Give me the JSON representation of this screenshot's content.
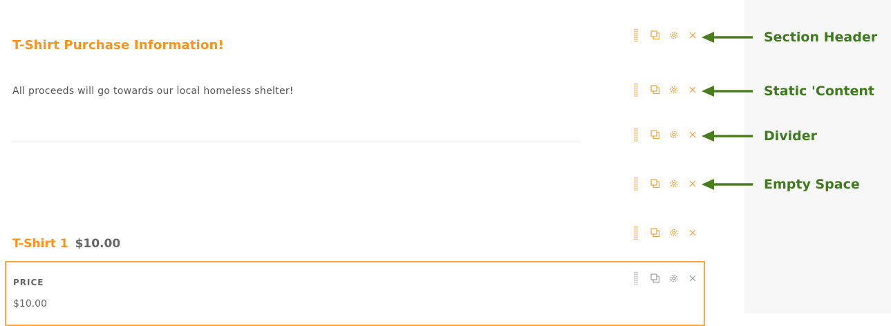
{
  "form": {
    "section_header": "T-Shirt Purchase Information!",
    "static_content": "All proceeds will go towards our local homeless shelter!",
    "product": {
      "name": "T-Shirt 1",
      "price": "$10.00"
    },
    "price_field": {
      "label": "PRICE",
      "value": "$10.00"
    }
  },
  "annotations": [
    {
      "label": "Section Header"
    },
    {
      "label": "Static 'Content"
    },
    {
      "label": "Divider"
    },
    {
      "label": "Empty Space"
    }
  ],
  "icons": {
    "drag": "drag-handle-icon",
    "duplicate": "duplicate-icon",
    "settings": "gear-icon",
    "delete": "close-icon"
  },
  "colors": {
    "accent": "#f7931e",
    "annotation": "#3f7a1e",
    "muted_text": "#666666",
    "panel": "#f7f7f7"
  }
}
